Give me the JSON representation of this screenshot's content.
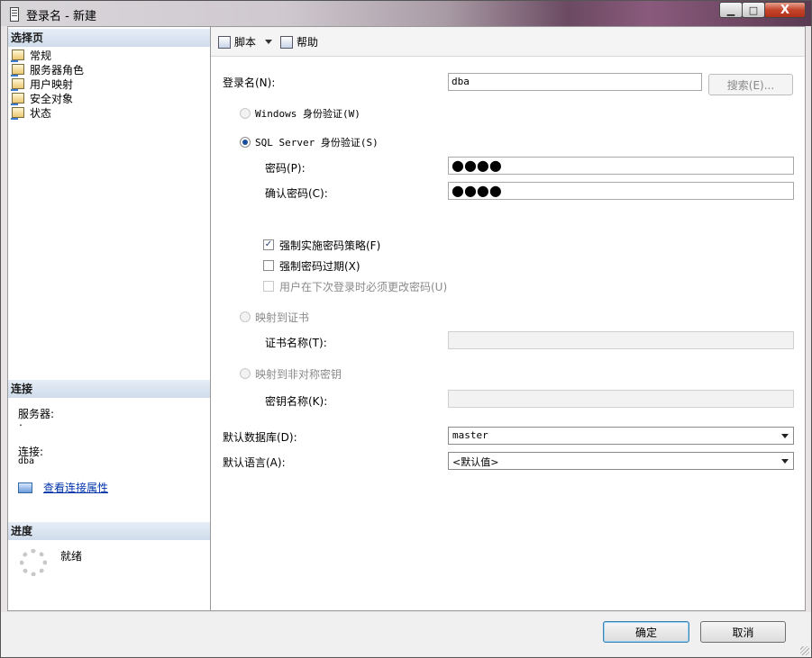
{
  "window": {
    "title": "登录名 - 新建",
    "icon": "document-icon",
    "minimize": "▁",
    "maximize": "□",
    "close": "X"
  },
  "left": {
    "select_page_header": "选择页",
    "pages": [
      {
        "label": "常规",
        "icon": "page-icon"
      },
      {
        "label": "服务器角色",
        "icon": "page-icon"
      },
      {
        "label": "用户映射",
        "icon": "page-icon"
      },
      {
        "label": "安全对象",
        "icon": "page-icon"
      },
      {
        "label": "状态",
        "icon": "page-icon"
      }
    ],
    "connection_header": "连接",
    "server_label": "服务器:",
    "server_value": ".",
    "connection_label": "连接:",
    "connection_value": "dba",
    "view_props_link": "查看连接属性",
    "progress_header": "进度",
    "progress_status": "就绪"
  },
  "toolbar": {
    "script_label": "脚本",
    "help_label": "帮助"
  },
  "form": {
    "login_name_label": "登录名(N):",
    "login_name_value": "dba",
    "search_button": "搜索(E)...",
    "windows_auth_label": "Windows 身份验证(W)",
    "sql_auth_label": "SQL Server 身份验证(S)",
    "auth_selected": "sql",
    "password_label": "密码(P):",
    "password_value": "●●●●",
    "confirm_password_label": "确认密码(C):",
    "confirm_password_value": "●●●●",
    "enforce_policy_label": "强制实施密码策略(F)",
    "enforce_policy_checked": true,
    "enforce_expiration_label": "强制密码过期(X)",
    "enforce_expiration_checked": false,
    "must_change_label": "用户在下次登录时必须更改密码(U)",
    "must_change_checked": false,
    "map_cert_label": "映射到证书",
    "cert_name_label": "证书名称(T):",
    "map_asym_label": "映射到非对称密钥",
    "key_name_label": "密钥名称(K):",
    "default_db_label": "默认数据库(D):",
    "default_db_value": "master",
    "default_lang_label": "默认语言(A):",
    "default_lang_value": "<默认值>"
  },
  "footer": {
    "ok_button": "确定",
    "cancel_button": "取消"
  }
}
